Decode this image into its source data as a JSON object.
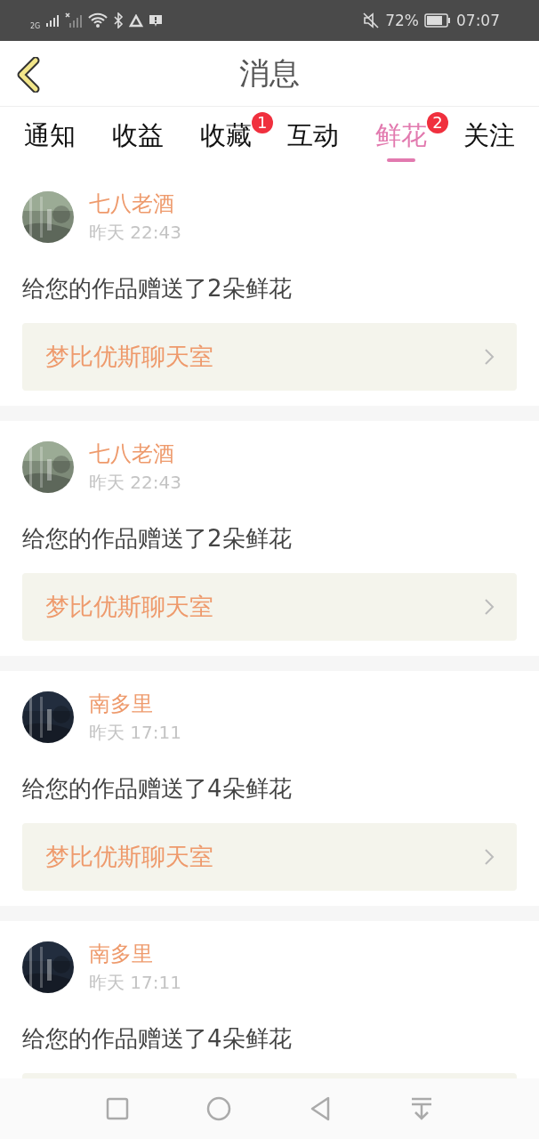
{
  "status_bar": {
    "network": "2G",
    "battery": "72%",
    "time": "07:07"
  },
  "header": {
    "title": "消息"
  },
  "tabs": [
    {
      "label": "通知",
      "selected": false
    },
    {
      "label": "收益",
      "selected": false
    },
    {
      "label": "收藏",
      "selected": false,
      "badge": "1"
    },
    {
      "label": "互动",
      "selected": false
    },
    {
      "label": "鲜花",
      "selected": true,
      "badge": "2"
    },
    {
      "label": "关注",
      "selected": false
    }
  ],
  "messages": [
    {
      "name": "七八老酒",
      "time": "昨天 22:43",
      "text": "给您的作品赠送了2朵鲜花",
      "link": "梦比优斯聊天室"
    },
    {
      "name": "七八老酒",
      "time": "昨天 22:43",
      "text": "给您的作品赠送了2朵鲜花",
      "link": "梦比优斯聊天室"
    },
    {
      "name": "南多里",
      "time": "昨天 17:11",
      "text": "给您的作品赠送了4朵鲜花",
      "link": "梦比优斯聊天室"
    },
    {
      "name": "南多里",
      "time": "昨天 17:11",
      "text": "给您的作品赠送了4朵鲜花"
    }
  ]
}
